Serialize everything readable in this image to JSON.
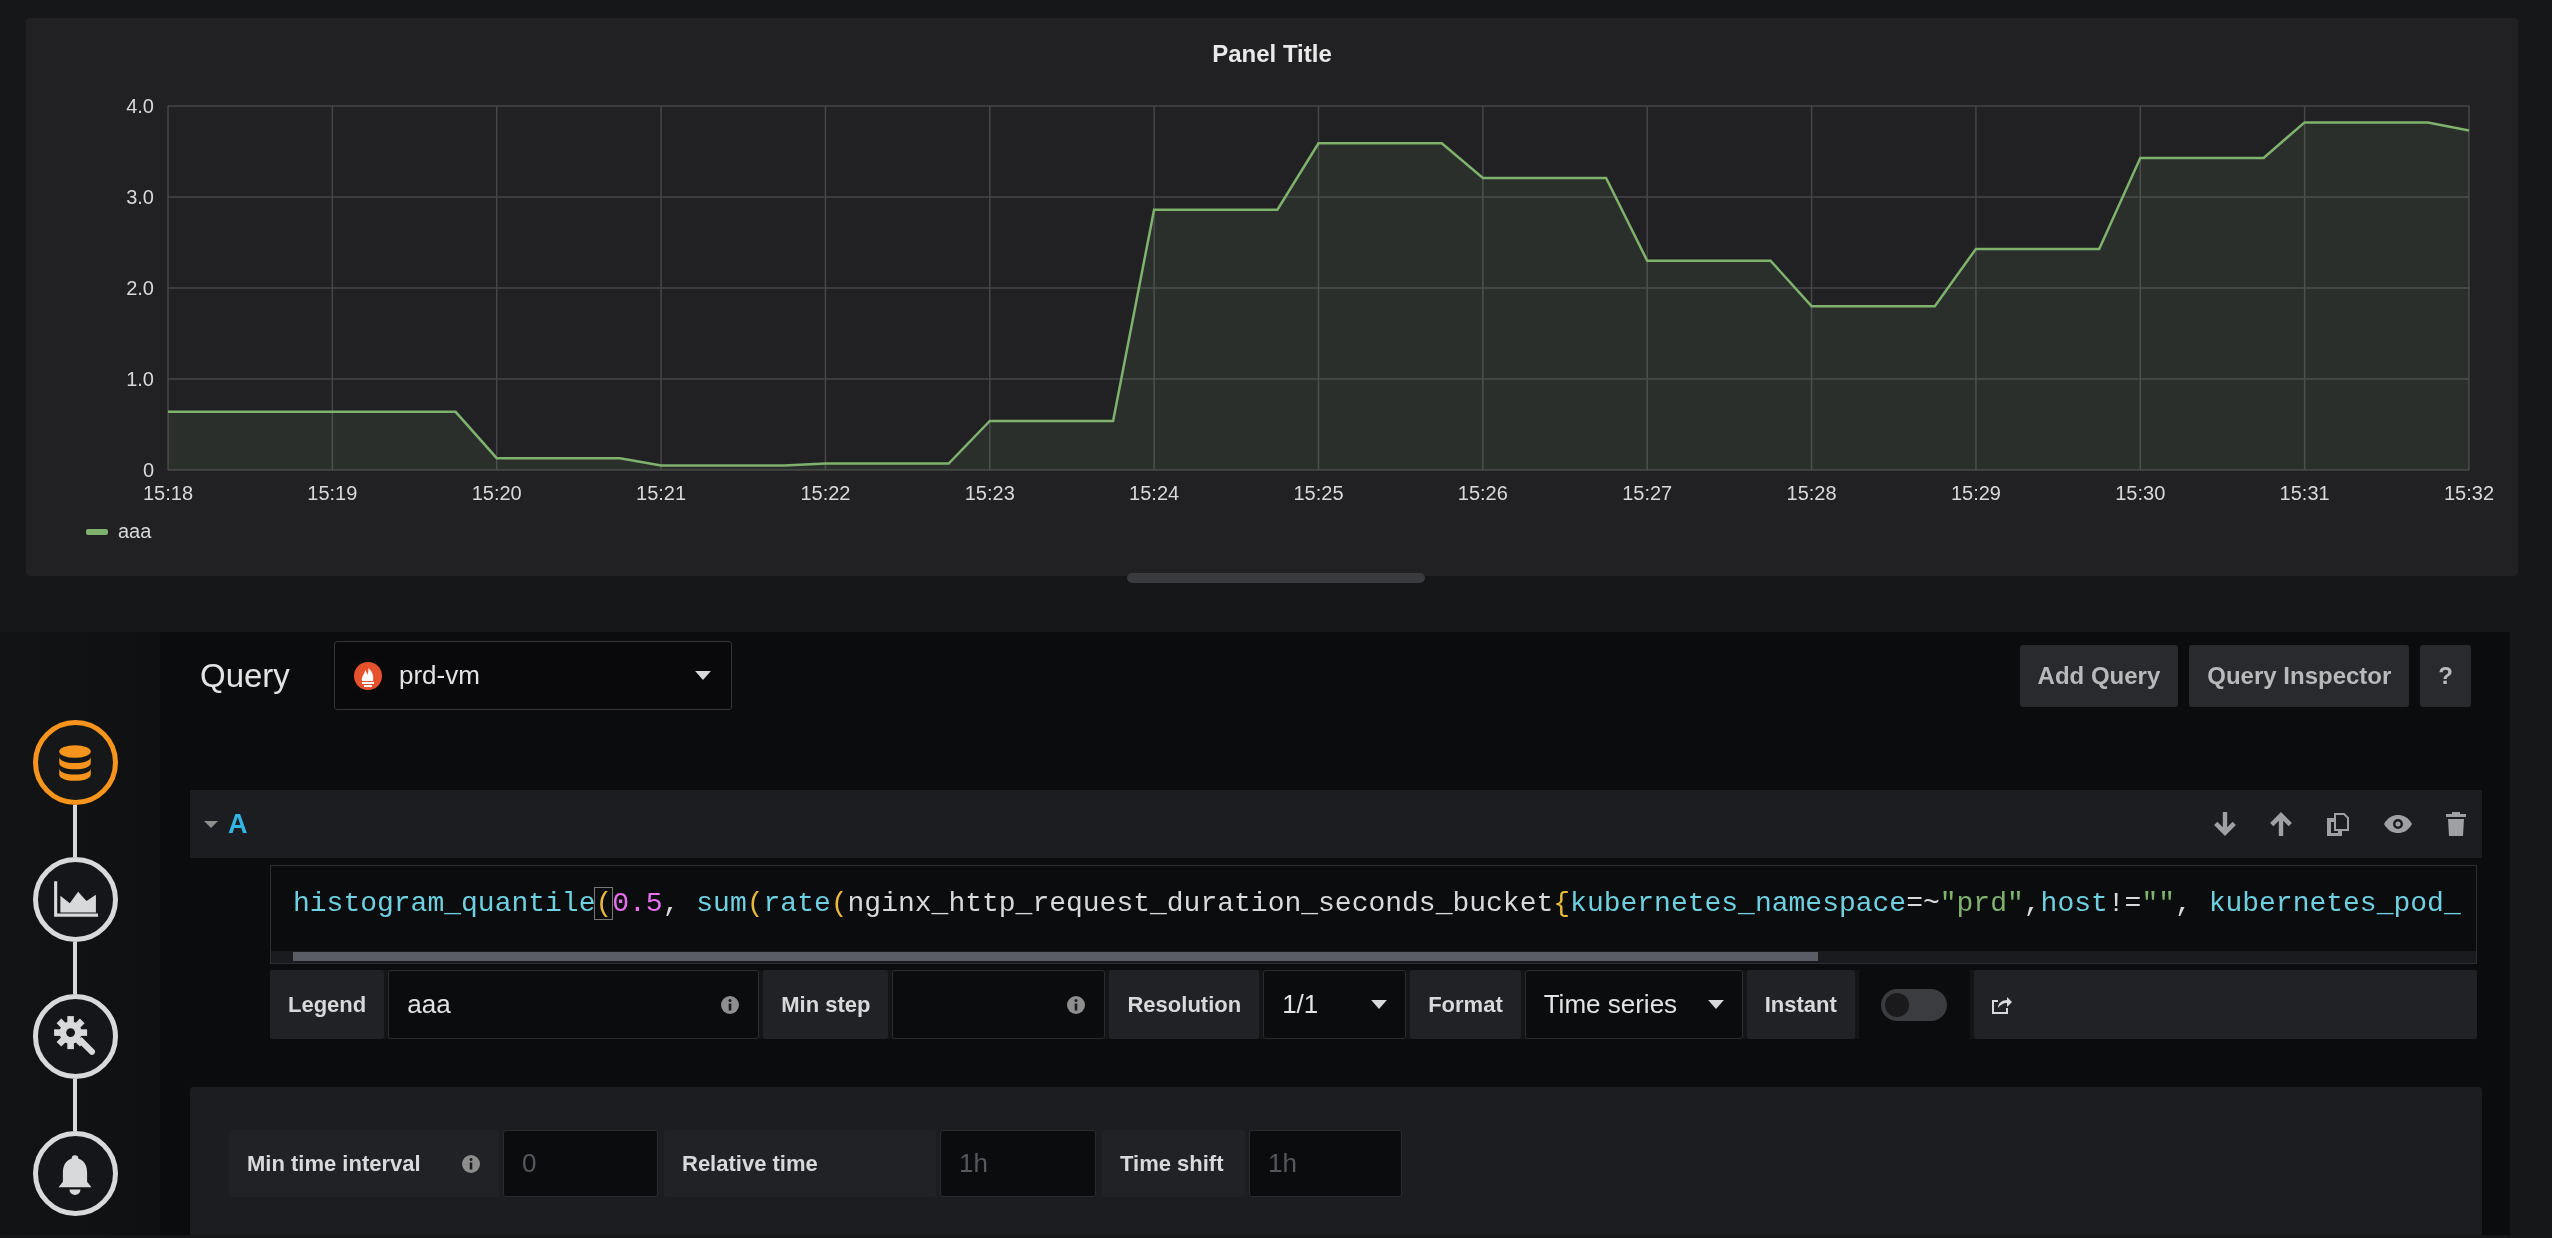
{
  "panel": {
    "title": "Panel Title",
    "chart_data": {
      "type": "area",
      "x": [
        918,
        919.75,
        920,
        920.75,
        921,
        921.75,
        922,
        922.75,
        923,
        923.75,
        924,
        924.75,
        925,
        925.75,
        926,
        926.75,
        927,
        927.75,
        928,
        928.75,
        929,
        929.75,
        930,
        930.75,
        931,
        931.75,
        932
      ],
      "series": [
        {
          "name": "aaa",
          "color": "#7eb26d",
          "values": [
            0.64,
            0.64,
            0.13,
            0.13,
            0.05,
            0.05,
            0.07,
            0.07,
            0.54,
            0.54,
            2.86,
            2.86,
            3.59,
            3.59,
            3.21,
            3.21,
            2.3,
            2.3,
            1.8,
            1.8,
            2.43,
            2.43,
            3.43,
            3.43,
            3.82,
            3.82,
            3.73
          ]
        }
      ],
      "xlim": [
        918,
        932
      ],
      "ylim": [
        0,
        4
      ],
      "grid": true,
      "xticks": [
        {
          "value": 918,
          "label": "15:18"
        },
        {
          "value": 919,
          "label": "15:19"
        },
        {
          "value": 920,
          "label": "15:20"
        },
        {
          "value": 921,
          "label": "15:21"
        },
        {
          "value": 922,
          "label": "15:22"
        },
        {
          "value": 923,
          "label": "15:23"
        },
        {
          "value": 924,
          "label": "15:24"
        },
        {
          "value": 925,
          "label": "15:25"
        },
        {
          "value": 926,
          "label": "15:26"
        },
        {
          "value": 927,
          "label": "15:27"
        },
        {
          "value": 928,
          "label": "15:28"
        },
        {
          "value": 929,
          "label": "15:29"
        },
        {
          "value": 930,
          "label": "15:30"
        },
        {
          "value": 931,
          "label": "15:31"
        },
        {
          "value": 932,
          "label": "15:32"
        }
      ],
      "yticks": [
        {
          "value": 0,
          "label": "0"
        },
        {
          "value": 1,
          "label": "1.0"
        },
        {
          "value": 2,
          "label": "2.0"
        },
        {
          "value": 3,
          "label": "3.0"
        },
        {
          "value": 4,
          "label": "4.0"
        }
      ]
    }
  },
  "sidebar": {
    "items": [
      {
        "kind": "queries",
        "selected": true
      },
      {
        "kind": "visualization",
        "selected": false
      },
      {
        "kind": "general",
        "selected": false
      },
      {
        "kind": "alert",
        "selected": false
      }
    ]
  },
  "query_editor": {
    "title": "Query",
    "datasource": {
      "value": "prd-vm"
    },
    "buttons": [
      {
        "label": "Add Query"
      },
      {
        "label": "Query Inspector"
      },
      {
        "label": "?"
      }
    ],
    "queries": [
      {
        "ref": "A",
        "expanded": true,
        "expression": [
          {
            "text": "histogram_quantile",
            "kind": "function"
          },
          {
            "text": "(",
            "kind": "matched-bracket"
          },
          {
            "text": "0.5",
            "kind": "number"
          },
          {
            "text": ", ",
            "kind": "plain"
          },
          {
            "text": "sum",
            "kind": "function"
          },
          {
            "text": "(",
            "kind": "bracket"
          },
          {
            "text": "rate",
            "kind": "function"
          },
          {
            "text": "(",
            "kind": "bracket"
          },
          {
            "text": "nginx_http_request_duration_seconds_bucket",
            "kind": "plain"
          },
          {
            "text": "{",
            "kind": "bracket"
          },
          {
            "text": "kubernetes_namespace",
            "kind": "label"
          },
          {
            "text": "=~",
            "kind": "plain"
          },
          {
            "text": "\"prd\"",
            "kind": "string"
          },
          {
            "text": ",",
            "kind": "plain"
          },
          {
            "text": "host",
            "kind": "label"
          },
          {
            "text": "!=",
            "kind": "plain"
          },
          {
            "text": "\"\"",
            "kind": "string"
          },
          {
            "text": ", ",
            "kind": "plain"
          },
          {
            "text": "kubernetes_pod_",
            "kind": "label"
          }
        ],
        "options": [
          {
            "kind": "input",
            "label": "Legend",
            "value": "aaa",
            "info": true
          },
          {
            "kind": "input",
            "label": "Min step",
            "info": true
          },
          {
            "kind": "select",
            "label": "Resolution",
            "value": "1/1"
          },
          {
            "kind": "select",
            "label": "Format",
            "value": "Time series"
          },
          {
            "kind": "toggle",
            "label": "Instant",
            "on": false
          }
        ]
      }
    ],
    "options": [
      {
        "label": "Min time interval",
        "info": true,
        "placeholder": "0"
      },
      {
        "label": "Relative time",
        "info": false,
        "placeholder": "1h"
      },
      {
        "label": "Time shift",
        "info": false,
        "placeholder": "1h"
      }
    ]
  }
}
